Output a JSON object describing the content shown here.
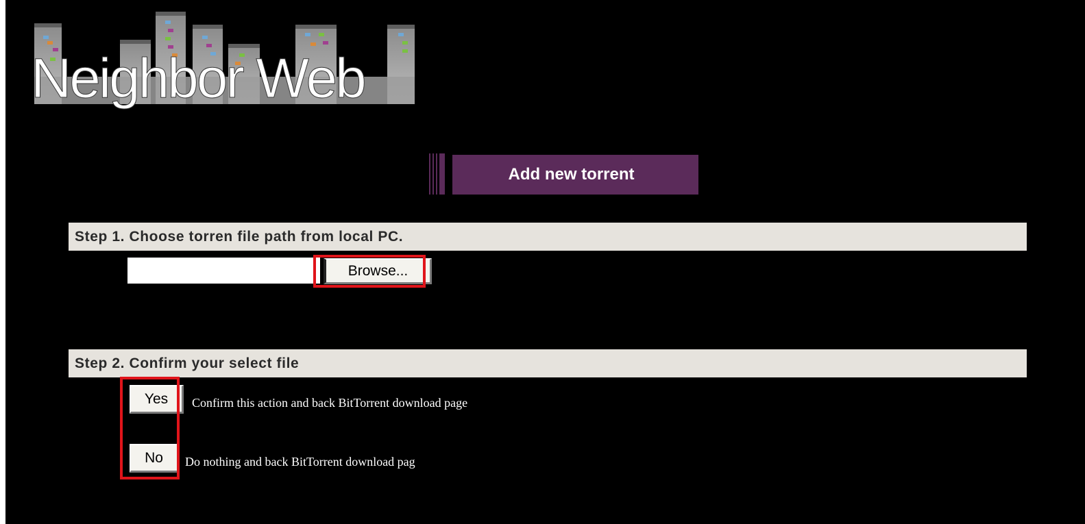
{
  "logo": {
    "text": "Neighbor Web"
  },
  "title": "Add new torrent",
  "step1": {
    "label": "Step 1. Choose torren file path from local PC.",
    "file_input_value": "",
    "browse_label": "Browse..."
  },
  "step2": {
    "label": "Step 2. Confirm your select file",
    "yes_label": "Yes",
    "yes_description": "Confirm this action and back BitTorrent download page",
    "no_label": "No",
    "no_description": "Do nothing and back BitTorrent download pag"
  },
  "colors": {
    "background": "#000000",
    "title_bg": "#5b2b5a",
    "step_bar_bg": "#e6e3dd",
    "highlight": "#e0141a"
  },
  "icons": [
    "city-buildings-logo"
  ]
}
